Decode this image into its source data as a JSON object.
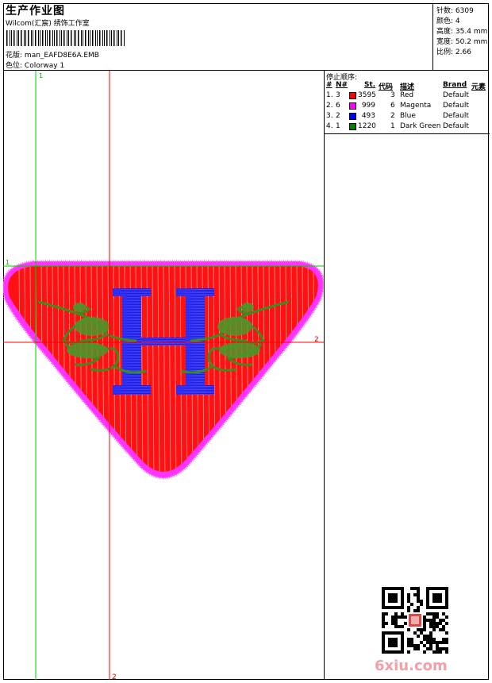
{
  "header": {
    "title": "生产作业图",
    "company": "Wilcom(汇宸) 绣饰工作室",
    "design_label": "花版:",
    "design_value": "man_EAFD8E6A.EMB",
    "colorway_label": "色位:",
    "colorway_value": "Colorway 1"
  },
  "stats": [
    {
      "label": "针数:",
      "value": "6309"
    },
    {
      "label": "颜色:",
      "value": "4"
    },
    {
      "label": "高度:",
      "value": "35.4 mm"
    },
    {
      "label": "宽度:",
      "value": "50.2 mm"
    },
    {
      "label": "比例:",
      "value": "2.66"
    }
  ],
  "thread_panel": {
    "title": "停止顺序:",
    "columns": [
      "#",
      "N#",
      "St.",
      "代码",
      "描述",
      "Brand",
      "元素"
    ],
    "rows": [
      {
        "num": "1.",
        "n": "3",
        "color": "#ff0000",
        "st": "3595",
        "code": "3",
        "desc": "Red",
        "brand": "Default"
      },
      {
        "num": "2.",
        "n": "6",
        "color": "#ff00ff",
        "st": "999",
        "code": "6",
        "desc": "Magenta",
        "brand": "Default"
      },
      {
        "num": "3.",
        "n": "2",
        "color": "#0000ff",
        "st": "493",
        "code": "2",
        "desc": "Blue",
        "brand": "Default"
      },
      {
        "num": "4.",
        "n": "1",
        "color": "#008000",
        "st": "1220",
        "code": "1",
        "desc": "Dark Green",
        "brand": "Default"
      }
    ]
  },
  "guides": {
    "v1_label": "1",
    "h1_label": "1",
    "h2_label": "2",
    "v2_label": "2",
    "v1_color": "#00cc00",
    "v2_color": "#ff0000"
  },
  "watermark": "6xiu.com",
  "colors": {
    "red": "#ff1111",
    "magenta": "#ff33ff",
    "blue": "#1a1aee",
    "green": "#3c8c1e"
  }
}
